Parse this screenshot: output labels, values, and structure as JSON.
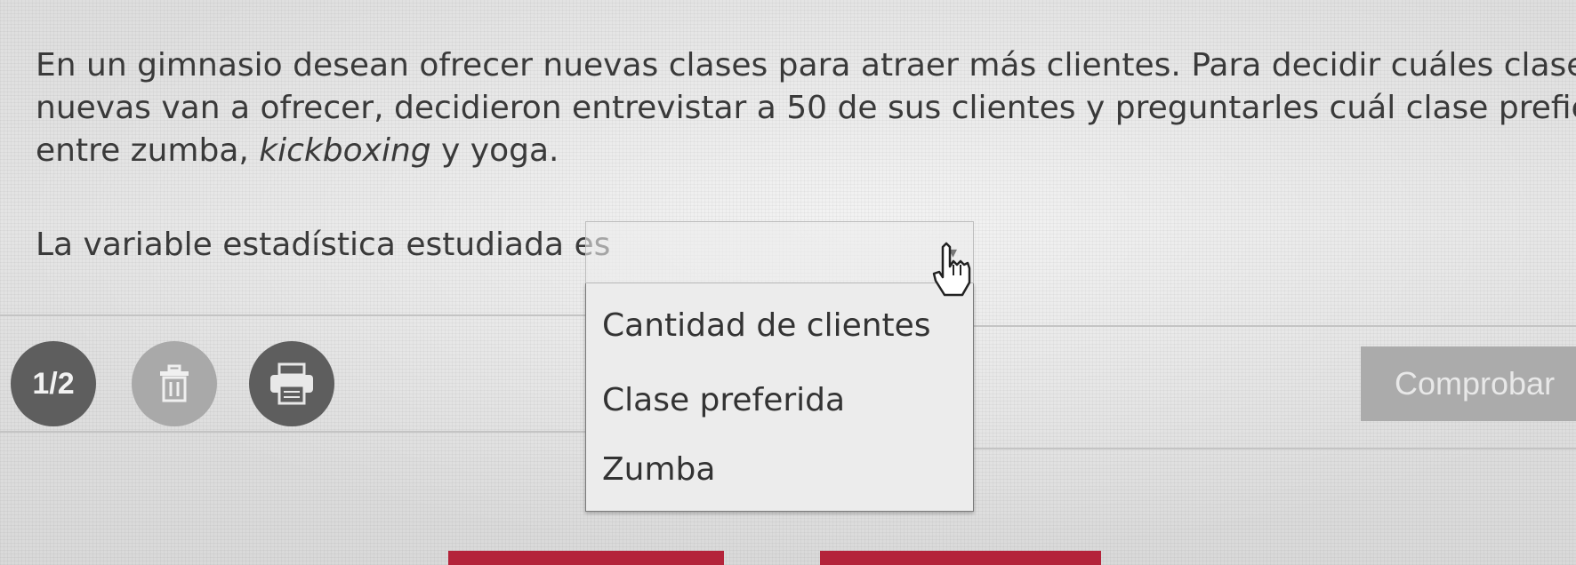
{
  "question": {
    "line1": "En un gimnasio desean ofrecer nuevas clases para atraer más clientes. Para decidir cuáles clases",
    "line2": "nuevas van a ofrecer, decidieron entrevistar a 50 de sus clientes y preguntarles cuál clase prefieren",
    "line3_start": "entre zumba, ",
    "line3_italic": "kickboxing",
    "line3_end": " y yoga."
  },
  "prompt": {
    "label": "La variable estadística estudiada es",
    "selected_value": ""
  },
  "dropdown": {
    "options": [
      "Cantidad de clientes",
      "Clase preferida",
      "Zumba"
    ]
  },
  "toolbar": {
    "page_indicator": "1/2",
    "trash_icon": "trash-icon",
    "print_icon": "print-icon",
    "check_label": "Comprobar"
  },
  "colors": {
    "accent_red": "#b4233a",
    "dark_button": "#5e5e5e",
    "light_button": "#a9a9a9",
    "check_button": "#ababab"
  }
}
